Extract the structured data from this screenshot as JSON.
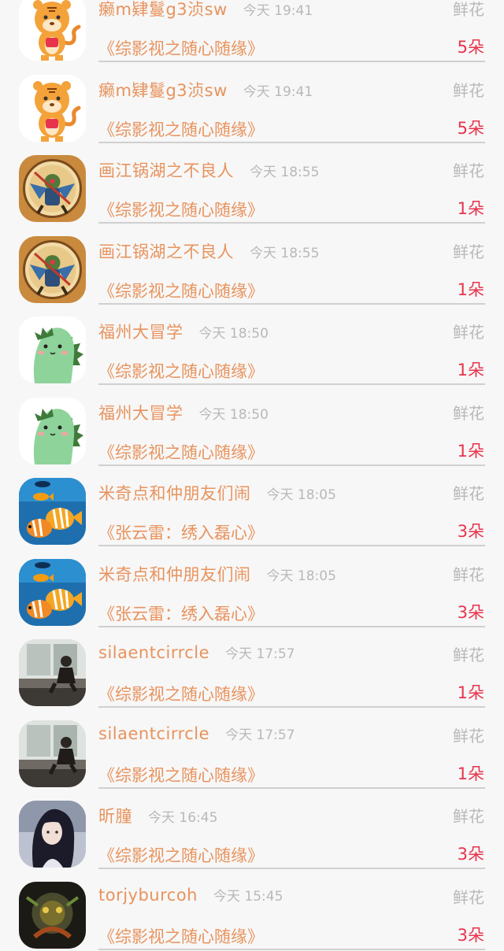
{
  "rows": [
    {
      "name": "癞m肄鬘g3浈sw",
      "time": "今天 19:41",
      "gift": "鲜花",
      "work": "《综影视之随心随缘》",
      "count": "5朵",
      "avatar_icon": "tiger-cartoon-icon"
    },
    {
      "name": "癞m肄鬘g3浈sw",
      "time": "今天 19:41",
      "gift": "鲜花",
      "work": "《综影视之随心随缘》",
      "count": "5朵",
      "avatar_icon": "tiger-cartoon-icon"
    },
    {
      "name": "画江锅湖之不良人",
      "time": "今天 18:55",
      "gift": "鲜花",
      "work": "《综影视之随心随缘》",
      "count": "1朵",
      "avatar_icon": "warrior-emblem-icon"
    },
    {
      "name": "画江锅湖之不良人",
      "time": "今天 18:55",
      "gift": "鲜花",
      "work": "《综影视之随心随缘》",
      "count": "1朵",
      "avatar_icon": "warrior-emblem-icon"
    },
    {
      "name": "福州大冒学",
      "time": "今天 18:50",
      "gift": "鲜花",
      "work": "《综影视之随心随缘》",
      "count": "1朵",
      "avatar_icon": "green-dinosaur-icon"
    },
    {
      "name": "福州大冒学",
      "time": "今天 18:50",
      "gift": "鲜花",
      "work": "《综影视之随心随缘》",
      "count": "1朵",
      "avatar_icon": "green-dinosaur-icon"
    },
    {
      "name": "米奇点和仲朋友们闹",
      "time": "今天 18:05",
      "gift": "鲜花",
      "work": "《张云雷：绣入磊心》",
      "count": "3朵",
      "avatar_icon": "tropical-fish-icon"
    },
    {
      "name": "米奇点和仲朋友们闹",
      "time": "今天 18:05",
      "gift": "鲜花",
      "work": "《张云雷：绣入磊心》",
      "count": "3朵",
      "avatar_icon": "tropical-fish-icon"
    },
    {
      "name": "silaentcirrcle",
      "time": "今天 17:57",
      "gift": "鲜花",
      "work": "《综影视之随心随缘》",
      "count": "1朵",
      "avatar_icon": "person-at-window-icon"
    },
    {
      "name": "silaentcirrcle",
      "time": "今天 17:57",
      "gift": "鲜花",
      "work": "《综影视之随心随缘》",
      "count": "1朵",
      "avatar_icon": "person-at-window-icon"
    },
    {
      "name": "昕膧",
      "time": "今天 16:45",
      "gift": "鲜花",
      "work": "《综影视之随心随缘》",
      "count": "3朵",
      "avatar_icon": "anime-girl-icon"
    },
    {
      "name": "torjyburcoh",
      "time": "今天 15:45",
      "gift": "鲜花",
      "work": "《综影视之随心随缘》",
      "count": "3朵",
      "avatar_icon": "dark-mech-icon"
    }
  ]
}
